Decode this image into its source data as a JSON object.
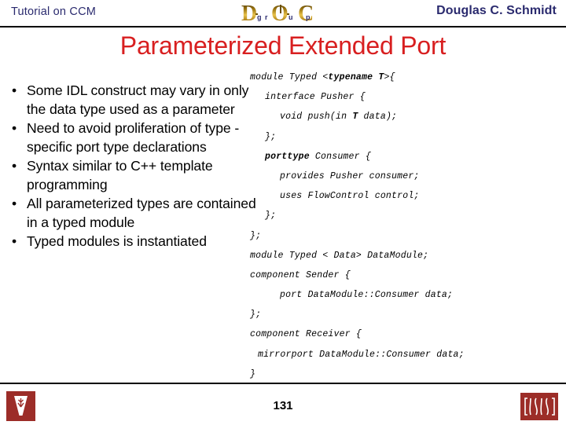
{
  "header": {
    "left_label": "Tutorial on CCM",
    "right_label": "Douglas C. Schmidt",
    "logo_name": "DOC Group",
    "logo_big_letters": [
      "D",
      "O",
      "C"
    ],
    "logo_small_letters": [
      "g",
      "r",
      "u",
      "p"
    ],
    "logo_color": "#b8860b",
    "text_color": "#2a2a6e"
  },
  "title": {
    "text": "Parameterized Extended Port",
    "color": "#d81f20"
  },
  "bullets": [
    {
      "marker": "•",
      "text": "Some IDL construct may vary in only the data type used as a parameter"
    },
    {
      "marker": "•",
      "text": "Need to avoid proliferation of type -specific port type declarations"
    },
    {
      "marker": "•",
      "text": "Syntax similar to C++ template programming"
    },
    {
      "marker": "•",
      "text": "All parameterized types are contained in a typed module"
    },
    {
      "marker": "•",
      "text": "Typed modules is instantiated"
    }
  ],
  "code": {
    "language": "IDL",
    "lines": [
      {
        "indent": 0,
        "pre": "module Typed <",
        "bold": "typename T",
        "post": ">{"
      },
      {
        "indent": 1,
        "pre": "interface Pusher {",
        "bold": "",
        "post": ""
      },
      {
        "indent": 2,
        "pre": "void push(in ",
        "bold": "T",
        "post": " data);"
      },
      {
        "indent": 1,
        "pre": "};",
        "bold": "",
        "post": ""
      },
      {
        "indent": 1,
        "pre": "",
        "bold": "porttype",
        "post": " Consumer {"
      },
      {
        "indent": 2,
        "pre": "provides Pusher consumer;",
        "bold": "",
        "post": ""
      },
      {
        "indent": 2,
        "pre": "uses FlowControl control;",
        "bold": "",
        "post": ""
      },
      {
        "indent": 1,
        "pre": "};",
        "bold": "",
        "post": ""
      },
      {
        "indent": 0,
        "pre": "};",
        "bold": "",
        "post": ""
      },
      {
        "indent": 0,
        "pre": "module Typed < Data> DataModule;",
        "bold": "",
        "post": ""
      },
      {
        "indent": 0,
        "pre": "component Sender {",
        "bold": "",
        "post": ""
      },
      {
        "indent": 2,
        "pre": "port DataModule::Consumer data;",
        "bold": "",
        "post": ""
      },
      {
        "indent": 0,
        "pre": "};",
        "bold": "",
        "post": ""
      },
      {
        "indent": 0,
        "pre": "component Receiver {",
        "bold": "",
        "post": ""
      },
      {
        "indent": 3,
        "pre": "mirrorport DataModule::Consumer data;",
        "bold": "",
        "post": ""
      },
      {
        "indent": 0,
        "pre": "}",
        "bold": "",
        "post": ""
      }
    ]
  },
  "footer": {
    "page_number": "131",
    "left_logo_name": "Vanderbilt University",
    "left_logo_letter": "V",
    "right_logo_name": "ISIS",
    "right_logo_text": "ISIS",
    "logo_color": "#9c2d28"
  }
}
